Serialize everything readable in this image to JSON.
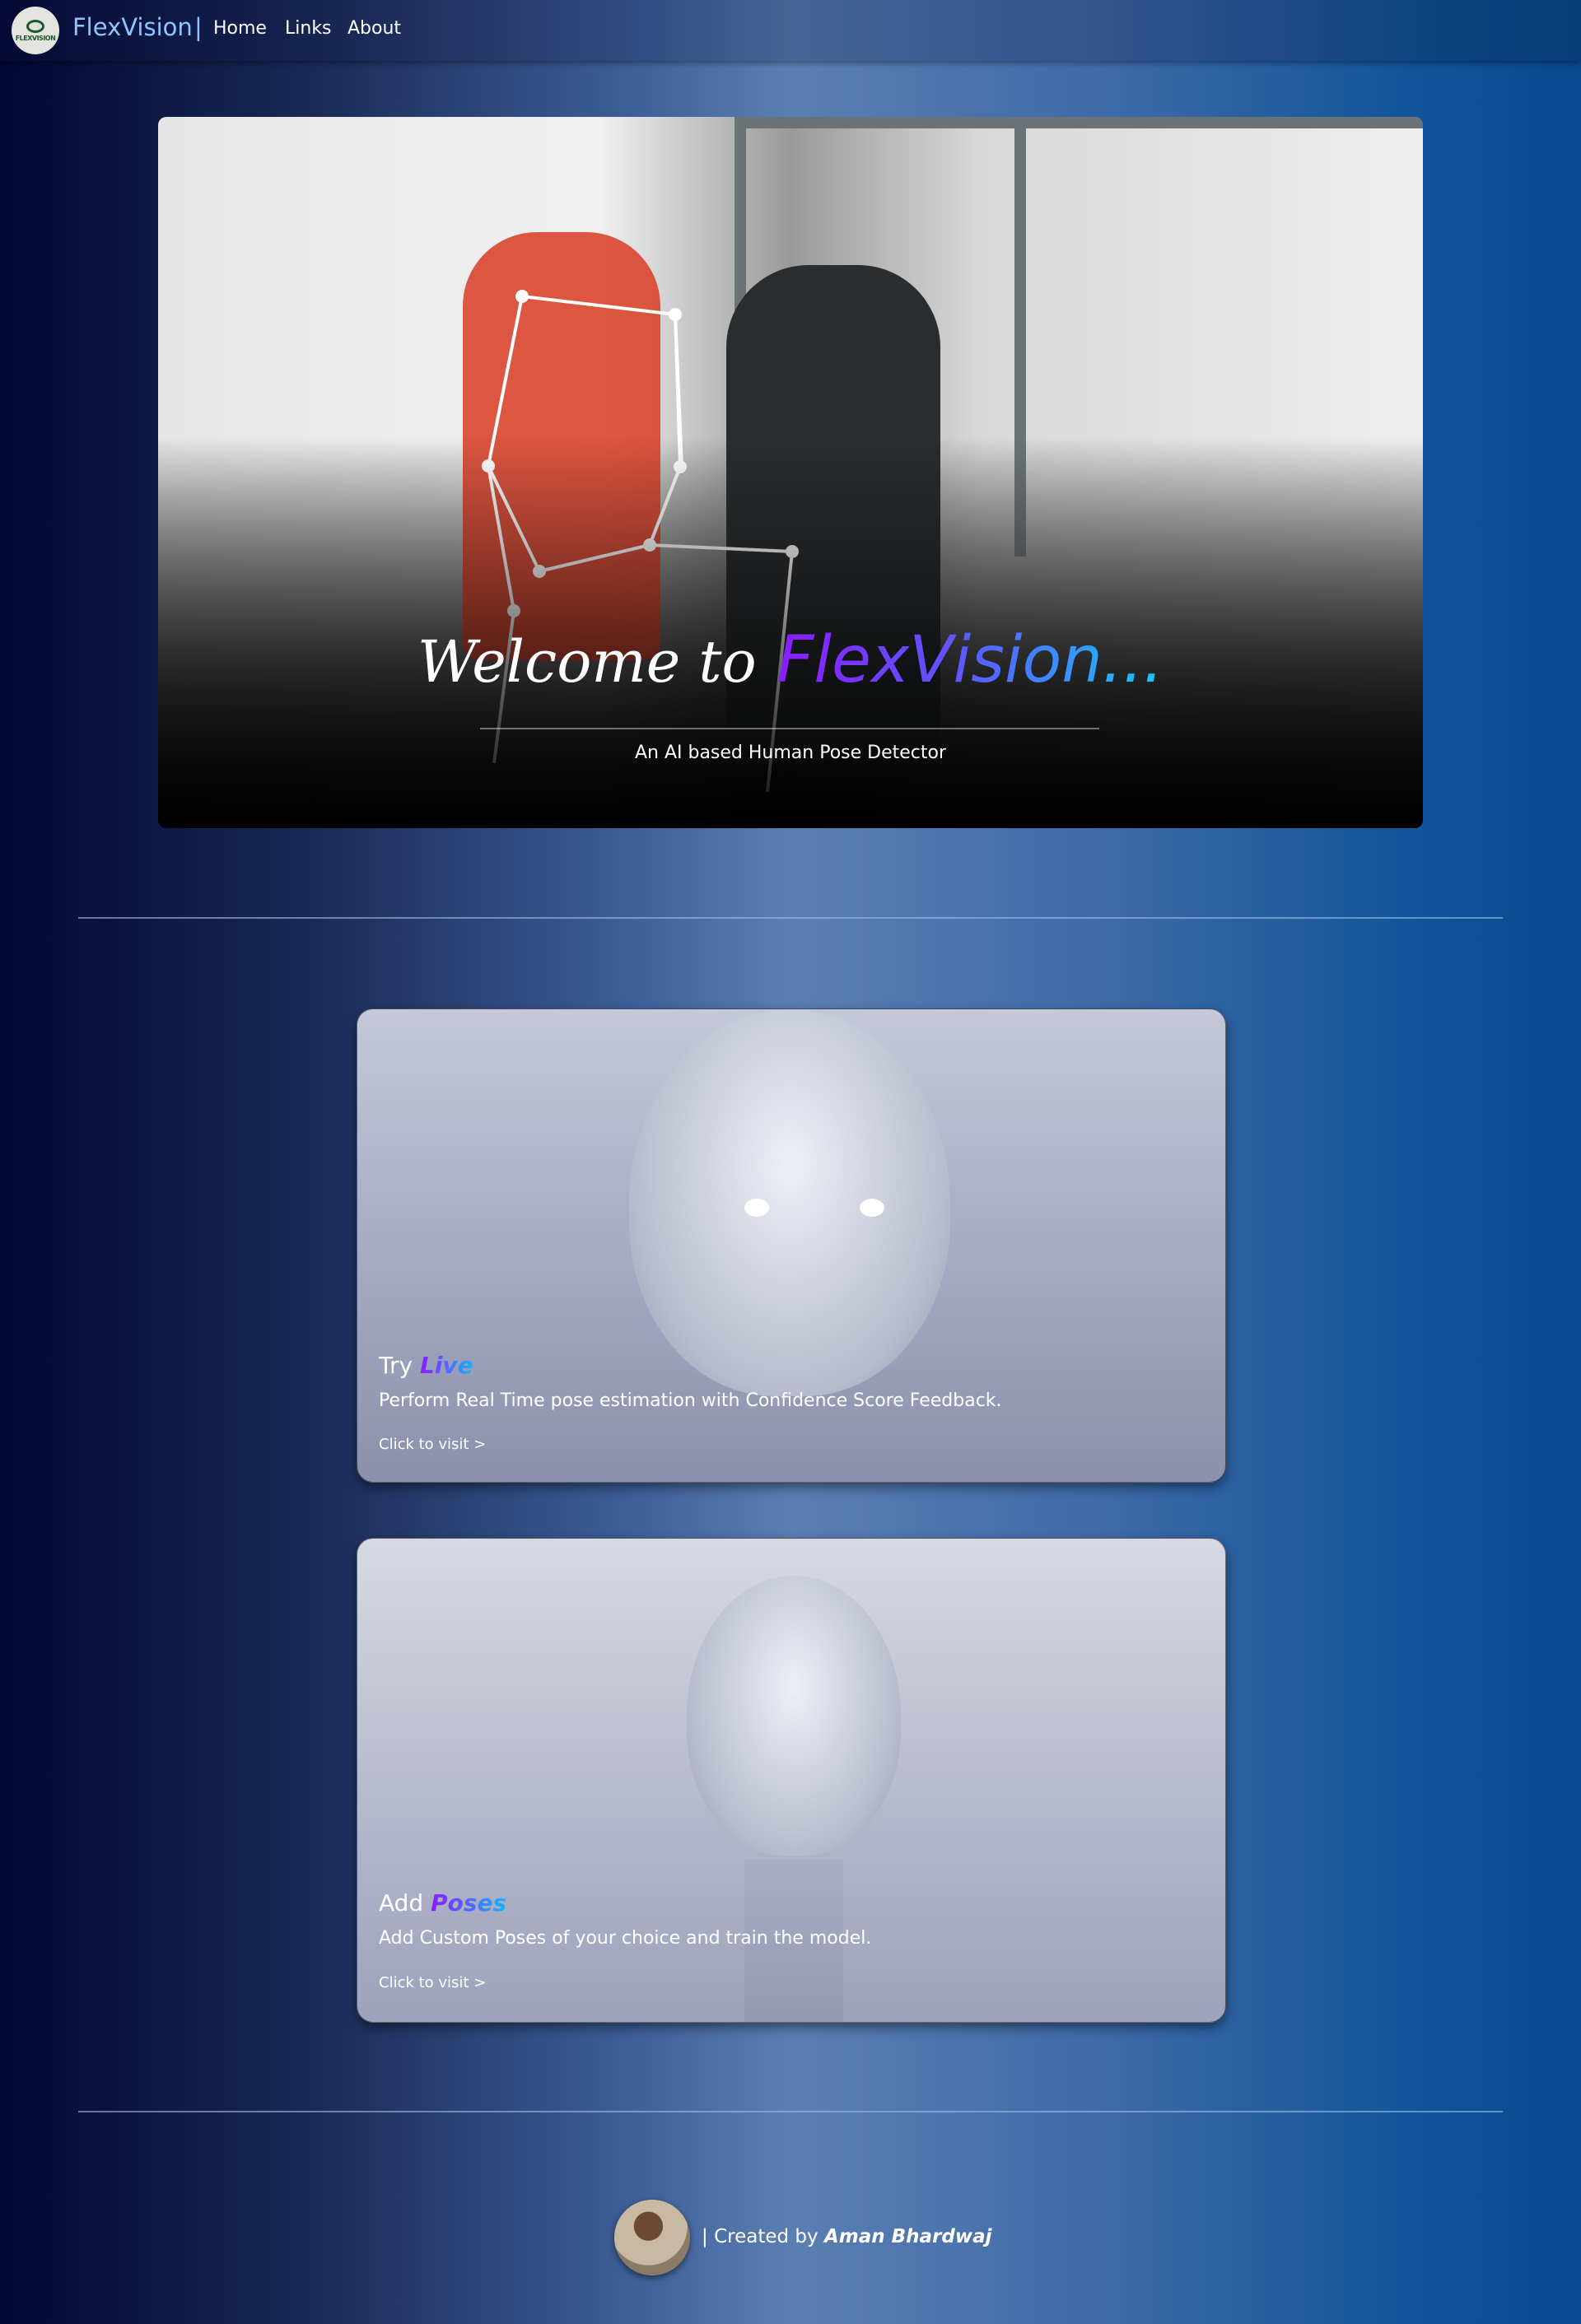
{
  "nav": {
    "logo_text": "FLEXVISION",
    "logo_subtext": "AI ESTIMATOR",
    "brand": "FlexVision",
    "separator": "|",
    "links": [
      {
        "label": "Home"
      },
      {
        "label": "Links"
      },
      {
        "label": "About"
      }
    ]
  },
  "hero": {
    "welcome": "Welcome to",
    "brand": "FlexVision...",
    "subtitle": "An AI based Human Pose Detector"
  },
  "cards": [
    {
      "title_plain": "Try",
      "title_accent": "Live",
      "description": "Perform Real Time pose estimation with Confidence Score Feedback.",
      "link": "Click to visit >"
    },
    {
      "title_plain": "Add",
      "title_accent": "Poses",
      "description": "Add Custom Poses of your choice and train the model.",
      "link": "Click to visit >"
    }
  ],
  "footer": {
    "separator": "|",
    "created_by": "Created by",
    "author": "Aman Bhardwaj"
  }
}
